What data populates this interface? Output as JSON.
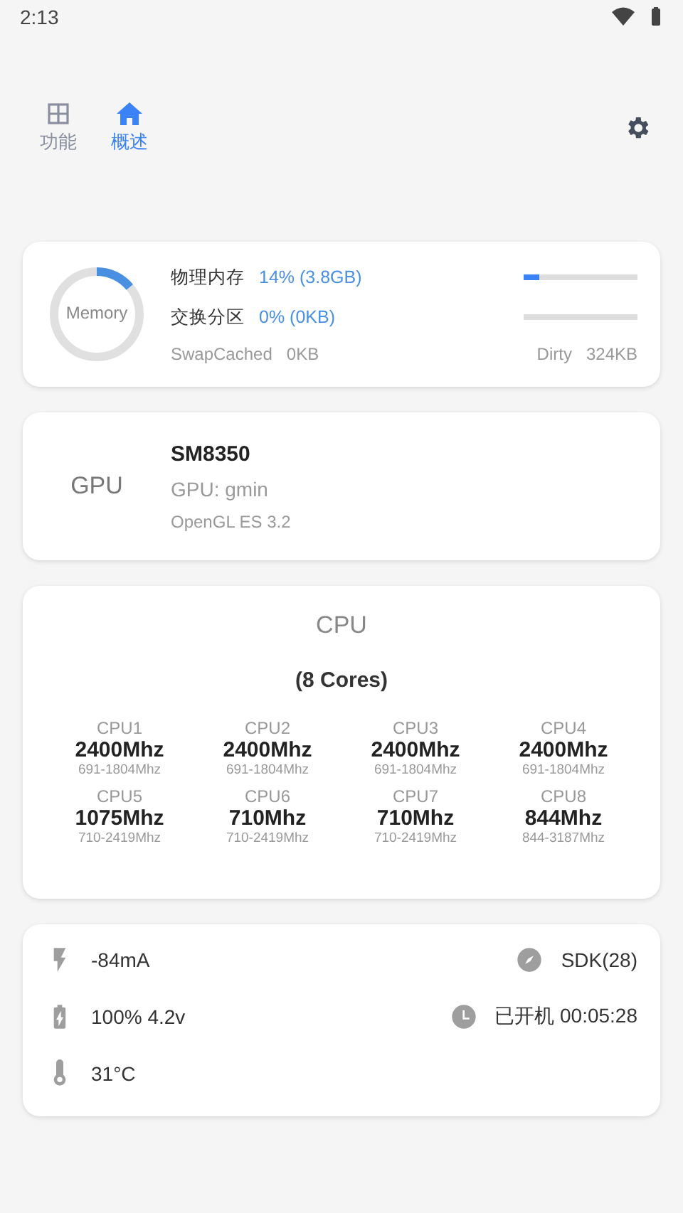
{
  "status_bar": {
    "time": "2:13"
  },
  "tabs": [
    {
      "label": "功能",
      "kind": "grid",
      "selected": false
    },
    {
      "label": "概述",
      "kind": "home",
      "selected": true
    }
  ],
  "memory": {
    "ring_label": "Memory",
    "level": 0.14,
    "rows": [
      {
        "label": "物理内存",
        "value": "14% (3.8GB)",
        "level": 0.14
      },
      {
        "label": "交换分区",
        "value": "0% (0KB)"
      }
    ],
    "swap_cached": {
      "label": "SwapCached",
      "value": "0KB"
    },
    "dirty": {
      "label": "Dirty",
      "value": "324KB"
    }
  },
  "gpu": {
    "heading": "GPU",
    "model": "SM8350",
    "renderer": "GPU: gmin",
    "api": "OpenGL ES 3.2"
  },
  "cpu": {
    "heading": "CPU",
    "cores": "(8 Cores)",
    "items": [
      {
        "name": "CPU1",
        "freq": "2400Mhz",
        "range": "691-1804Mhz"
      },
      {
        "name": "CPU2",
        "freq": "2400Mhz",
        "range": "691-1804Mhz"
      },
      {
        "name": "CPU3",
        "freq": "2400Mhz",
        "range": "691-1804Mhz"
      },
      {
        "name": "CPU4",
        "freq": "2400Mhz",
        "range": "691-1804Mhz"
      },
      {
        "name": "CPU5",
        "freq": "1075Mhz",
        "range": "710-2419Mhz"
      },
      {
        "name": "CPU6",
        "freq": "710Mhz",
        "range": "710-2419Mhz"
      },
      {
        "name": "CPU7",
        "freq": "710Mhz",
        "range": "710-2419Mhz"
      },
      {
        "name": "CPU8",
        "freq": "844Mhz",
        "range": "844-3187Mhz"
      }
    ]
  },
  "info": {
    "left": [
      {
        "kind": "bolt",
        "text": "-84mA"
      },
      {
        "kind": "battery",
        "text": "100% 4.2v"
      },
      {
        "kind": "thermometer",
        "text": "31°C"
      }
    ],
    "right": [
      {
        "kind": "compass",
        "text": "SDK(28)"
      },
      {
        "kind": "clock",
        "text": "已开机 00:05:28"
      }
    ]
  }
}
